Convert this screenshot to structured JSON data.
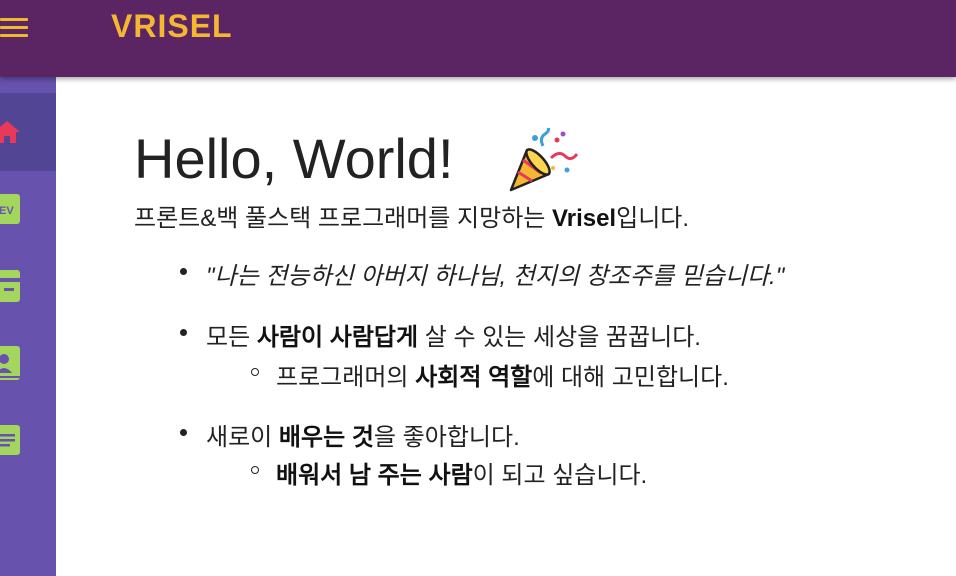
{
  "header": {
    "logo": "VRISEL"
  },
  "sidebar": {
    "items": [
      {
        "icon": "home-icon",
        "active": true
      },
      {
        "icon": "dev-icon",
        "label": "EV"
      },
      {
        "icon": "card-icon"
      },
      {
        "icon": "profile-card-icon"
      },
      {
        "icon": "document-icon"
      }
    ]
  },
  "main": {
    "title": "Hello, World!",
    "title_icon": "party-popper-icon",
    "intro_prefix": "프론트&백 풀스택 프로그래머를 지망하는 ",
    "intro_name": "Vrisel",
    "intro_suffix": "입니다.",
    "quote": "\"나는 전능하신 아버지 하나님, 천지의 창조주를 믿습니다.\"",
    "b2_prefix": "모든 ",
    "b2_bold": "사람이 사람답게",
    "b2_suffix": " 살 수 있는 세상을 꿈꿉니다.",
    "b2_sub_prefix": "프로그래머의 ",
    "b2_sub_bold": "사회적 역할",
    "b2_sub_suffix": "에 대해 고민합니다.",
    "b3_prefix": "새로이 ",
    "b3_bold": "배우는 것",
    "b3_suffix": "을 좋아합니다.",
    "b3_sub_bold": "배워서 남 주는 사람",
    "b3_sub_suffix": "이 되고 싶습니다."
  },
  "colors": {
    "header": "#5b2462",
    "sidebar": "#6752ad",
    "accent": "#f5b731",
    "home": "#e8395a",
    "icons": "#a4d65e"
  }
}
